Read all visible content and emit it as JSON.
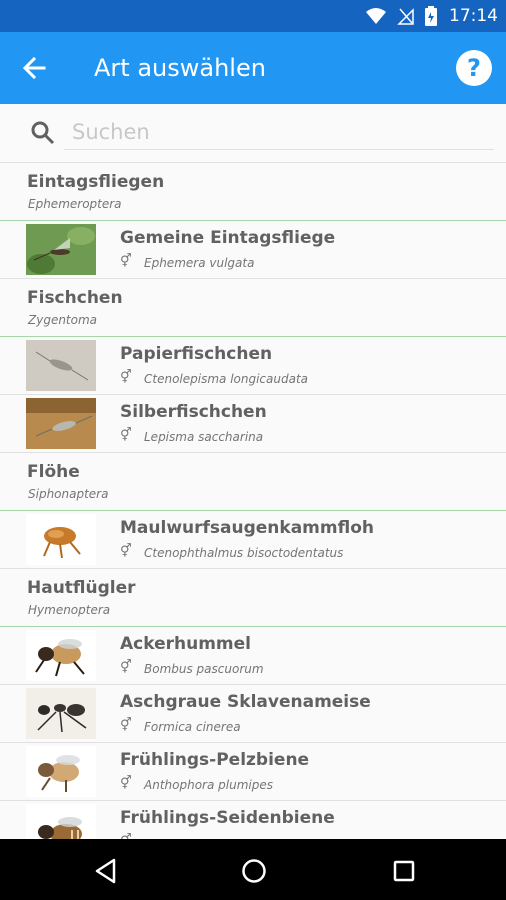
{
  "status_bar": {
    "time": "17:14",
    "icons": [
      "wifi-icon",
      "no-signal-icon",
      "battery-icon"
    ]
  },
  "app_bar": {
    "title": "Art auswählen",
    "back_icon": "arrow-back-icon",
    "help_label": "?"
  },
  "search": {
    "placeholder": "Suchen",
    "value": ""
  },
  "list": [
    {
      "type": "group",
      "name": "Eintagsfliegen",
      "scientific": "Ephemeroptera"
    },
    {
      "type": "species",
      "name": "Gemeine Eintagsfliege",
      "sex_icon": "⚥",
      "scientific": "Ephemera vulgata",
      "thumb": "mayfly-photo"
    },
    {
      "type": "group",
      "name": "Fischchen",
      "scientific": "Zygentoma"
    },
    {
      "type": "species",
      "name": "Papierfischchen",
      "sex_icon": "⚥",
      "scientific": "Ctenolepisma longicaudata",
      "thumb": "paper-silverfish-photo"
    },
    {
      "type": "species",
      "name": "Silberfischchen",
      "sex_icon": "⚥",
      "scientific": "Lepisma saccharina",
      "thumb": "silverfish-photo"
    },
    {
      "type": "group",
      "name": "Flöhe",
      "scientific": "Siphonaptera"
    },
    {
      "type": "species",
      "name": "Maulwurfsaugenkammfloh",
      "sex_icon": "⚥",
      "scientific": "Ctenophthalmus bisoctodentatus",
      "thumb": "flea-photo"
    },
    {
      "type": "group",
      "name": "Hautflügler",
      "scientific": "Hymenoptera"
    },
    {
      "type": "species",
      "name": "Ackerhummel",
      "sex_icon": "⚥",
      "scientific": "Bombus pascuorum",
      "thumb": "bumblebee-photo"
    },
    {
      "type": "species",
      "name": "Aschgraue Sklavenameise",
      "sex_icon": "⚥",
      "scientific": "Formica cinerea",
      "thumb": "ant-photo"
    },
    {
      "type": "species",
      "name": "Frühlings-Pelzbiene",
      "sex_icon": "⚥",
      "scientific": "Anthophora plumipes",
      "thumb": "furry-bee-photo"
    },
    {
      "type": "species",
      "name": "Frühlings-Seidenbiene",
      "sex_icon": "⚥",
      "scientific": "",
      "thumb": "silk-bee-photo"
    }
  ],
  "nav_bar": {
    "icons": [
      "back-triangle-icon",
      "home-circle-icon",
      "recents-square-icon"
    ]
  },
  "colors": {
    "app_bar": "#2196f3",
    "status_bar": "#1565c0",
    "group_divider": "#a5d6a7",
    "text": "#616161"
  }
}
